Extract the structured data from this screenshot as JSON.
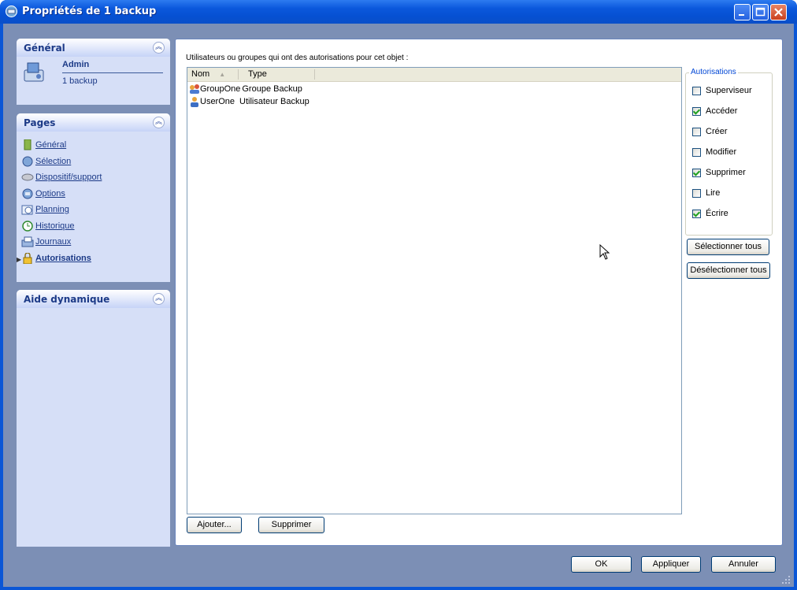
{
  "window": {
    "title": "Propriétés de 1 backup"
  },
  "sidebar": {
    "general": {
      "header": "Général",
      "name": "Admin",
      "subtitle": "1 backup"
    },
    "pages": {
      "header": "Pages",
      "items": [
        {
          "label": "Général",
          "icon": "page-icon"
        },
        {
          "label": "Sélection",
          "icon": "selection-icon"
        },
        {
          "label": "Dispositif/support",
          "icon": "device-icon"
        },
        {
          "label": "Options",
          "icon": "options-icon"
        },
        {
          "label": "Planning",
          "icon": "planning-icon"
        },
        {
          "label": "Historique",
          "icon": "history-icon"
        },
        {
          "label": "Journaux",
          "icon": "logs-icon"
        },
        {
          "label": "Autorisations",
          "icon": "lock-icon",
          "active": true
        }
      ]
    },
    "help": {
      "header": "Aide dynamique"
    }
  },
  "main": {
    "intro": "Utilisateurs ou groupes qui ont des autorisations pour cet objet :",
    "columns": [
      "Nom",
      "Type"
    ],
    "rows": [
      {
        "name": "GroupOne",
        "type": "Groupe Backup",
        "icon": "group-icon"
      },
      {
        "name": "UserOne",
        "type": "Utilisateur Backup",
        "icon": "user-icon"
      }
    ],
    "add_label": "Ajouter...",
    "remove_label": "Supprimer"
  },
  "permissions": {
    "title": "Autorisations",
    "items": [
      {
        "label": "Superviseur",
        "checked": false
      },
      {
        "label": "Accéder",
        "checked": true
      },
      {
        "label": "Créer",
        "checked": false
      },
      {
        "label": "Modifier",
        "checked": false
      },
      {
        "label": "Supprimer",
        "checked": true
      },
      {
        "label": "Lire",
        "checked": false
      },
      {
        "label": "Écrire",
        "checked": true
      }
    ],
    "select_all": "Sélectionner tous",
    "deselect_all": "Désélectionner tous"
  },
  "footer": {
    "ok": "OK",
    "apply": "Appliquer",
    "cancel": "Annuler"
  }
}
